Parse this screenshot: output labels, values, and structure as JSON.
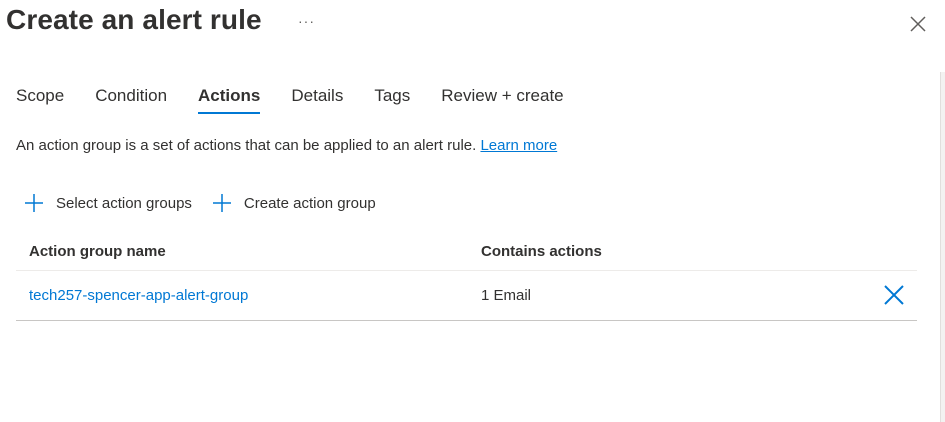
{
  "header": {
    "title": "Create an alert rule",
    "more_label": "···"
  },
  "tabs": [
    {
      "label": "Scope",
      "active": false
    },
    {
      "label": "Condition",
      "active": false
    },
    {
      "label": "Actions",
      "active": true
    },
    {
      "label": "Details",
      "active": false
    },
    {
      "label": "Tags",
      "active": false
    },
    {
      "label": "Review + create",
      "active": false
    }
  ],
  "actions": {
    "description": "An action group is a set of actions that can be applied to an alert rule.",
    "learn_more": "Learn more",
    "select_label": "Select action groups",
    "create_label": "Create action group"
  },
  "table": {
    "columns": [
      "Action group name",
      "Contains actions"
    ],
    "rows": [
      {
        "name": "tech257-spencer-app-alert-group",
        "contains": "1 Email"
      }
    ]
  },
  "colors": {
    "accent": "#0078d4",
    "text": "#323130"
  },
  "icons": {
    "more": "more-icon",
    "close": "close-icon",
    "add": "add-icon",
    "delete": "delete-icon"
  }
}
